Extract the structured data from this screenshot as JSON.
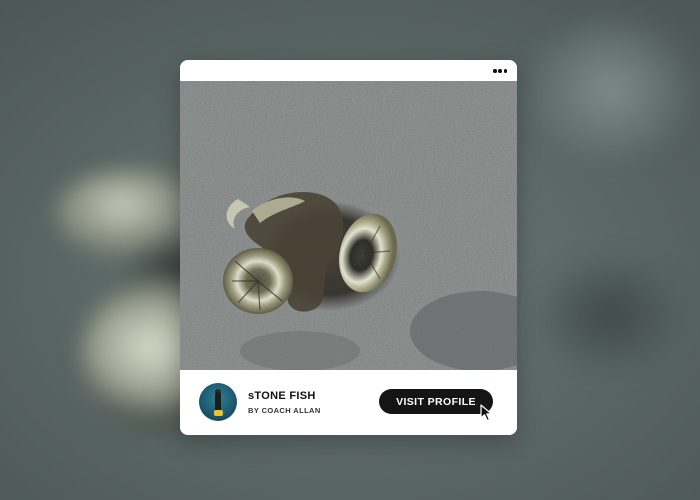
{
  "card": {
    "menu_icon": "more-horizontal-icon",
    "photo_subject": "stonefish-on-sand",
    "profile": {
      "name": "sTONE FISH",
      "author": "BY COACH ALLAN",
      "avatar_icon": "diver-avatar"
    },
    "visit_button_label": "VISIT PROFILE",
    "cursor_icon": "pointer-cursor-icon"
  },
  "colors": {
    "button_background": "#151515",
    "button_text": "#ffffff",
    "card_background": "#ffffff",
    "page_background": "#5f6b68"
  }
}
